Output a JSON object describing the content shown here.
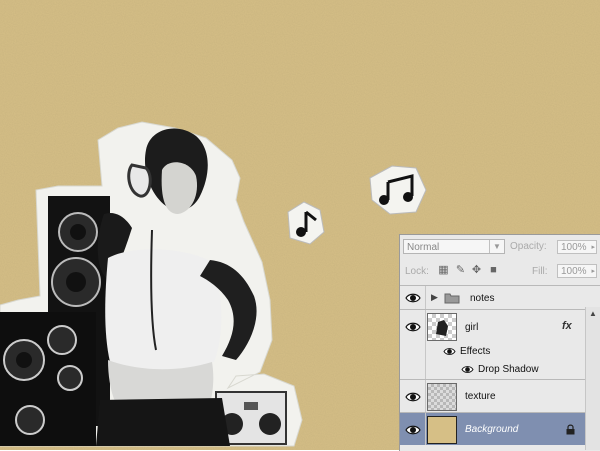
{
  "layers_panel": {
    "blend_mode": "Normal",
    "opacity_label": "Opacity:",
    "opacity_value": "100%",
    "lock_label": "Lock:",
    "fill_label": "Fill:",
    "fill_value": "100%",
    "layers": [
      {
        "name": "notes",
        "type": "group",
        "visible": true
      },
      {
        "name": "girl",
        "type": "layer",
        "visible": true,
        "fx": "fx"
      },
      {
        "name": "Effects",
        "type": "effects",
        "visible": true
      },
      {
        "name": "Drop Shadow",
        "type": "effect",
        "visible": true
      },
      {
        "name": "texture",
        "type": "layer",
        "visible": true
      },
      {
        "name": "Background",
        "type": "background",
        "visible": true,
        "locked": true,
        "selected": true
      }
    ]
  },
  "colors": {
    "canvas_bg": "#d6bf86",
    "selection": "#7f8fb0"
  }
}
